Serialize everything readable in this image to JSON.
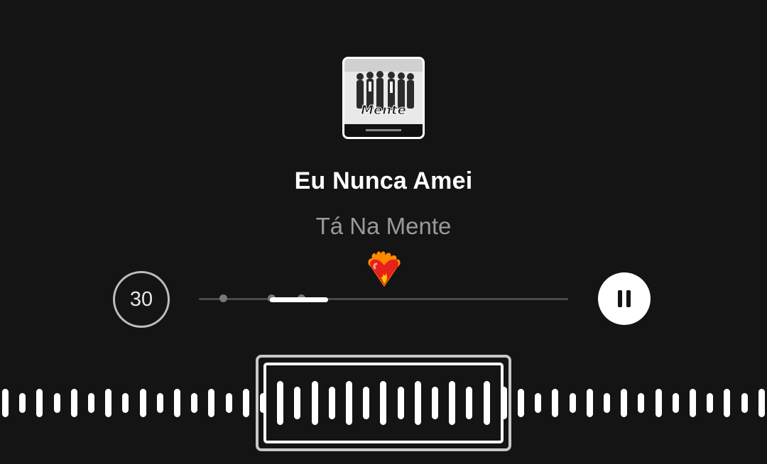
{
  "track": {
    "title": "Eu Nunca Amei",
    "artist": "Tá Na Mente",
    "album_art_icon": "album-cover-band-photo"
  },
  "reaction": {
    "icon": "heart-on-fire-emoji"
  },
  "controls": {
    "skip_label": "30",
    "skip_icon": "skip-30-seconds-circle",
    "pause_icon": "pause-icon",
    "progress_fraction": 0.35
  },
  "waveform": {
    "selection_icon": "trim-selection-window"
  },
  "colors": {
    "background": "#141414",
    "primary_text": "#ffffff",
    "secondary_text": "#9a9a9a",
    "accent": "#ffffff"
  }
}
